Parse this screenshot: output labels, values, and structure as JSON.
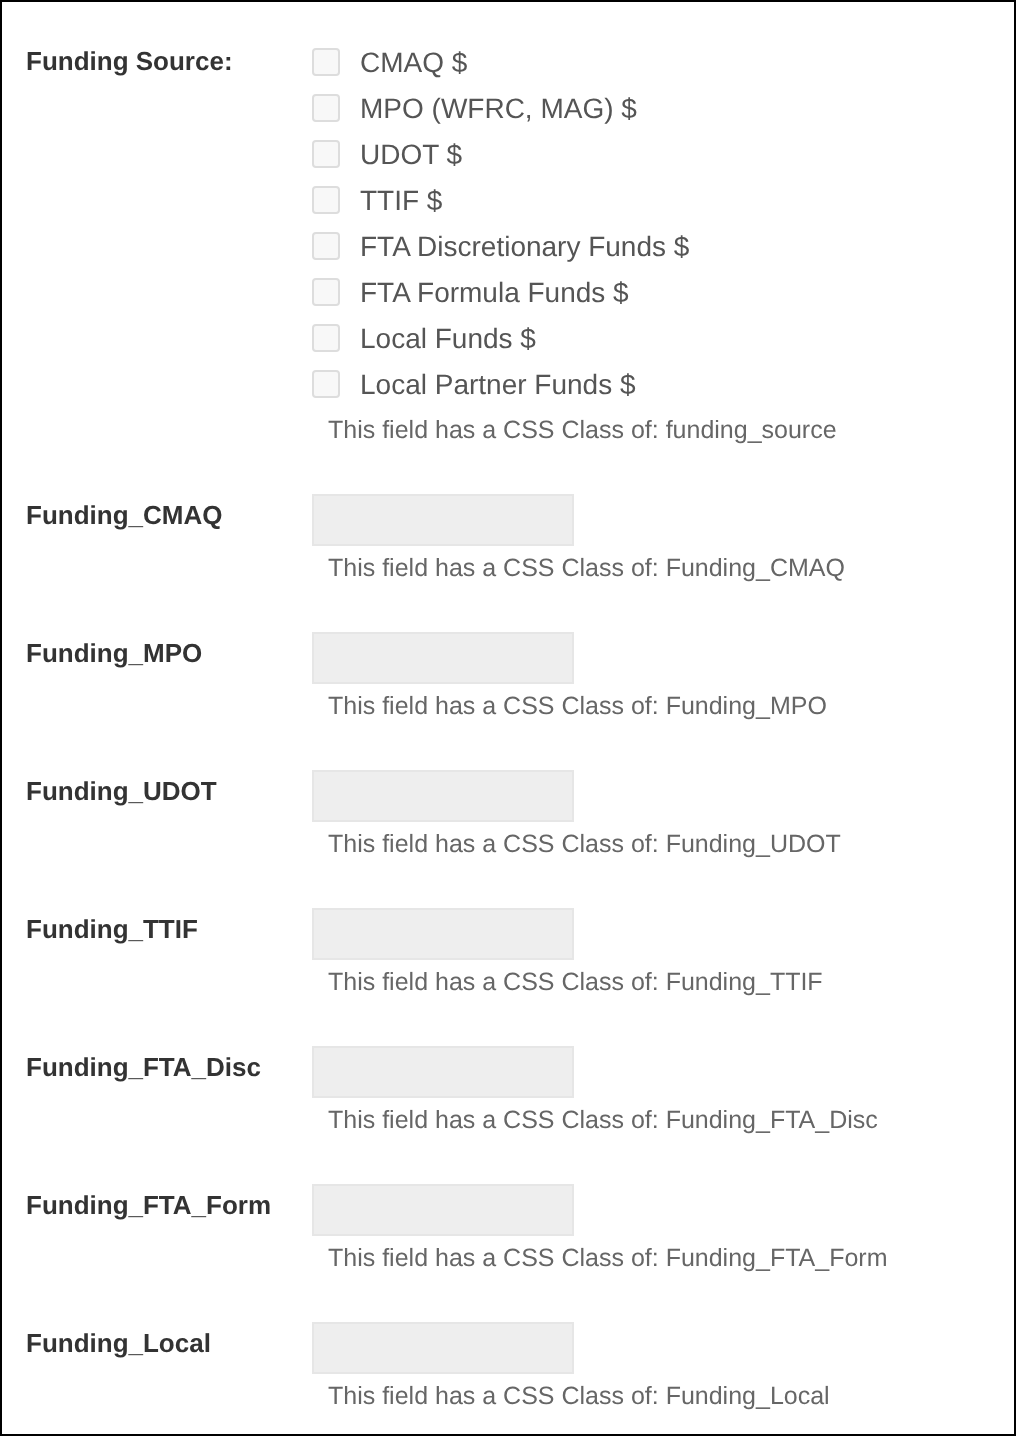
{
  "funding_source": {
    "label": "Funding Source:",
    "options": [
      {
        "label": "CMAQ $",
        "checked": false
      },
      {
        "label": "MPO (WFRC, MAG) $",
        "checked": false
      },
      {
        "label": "UDOT $",
        "checked": false
      },
      {
        "label": "TTIF $",
        "checked": false
      },
      {
        "label": "FTA Discretionary Funds $",
        "checked": false
      },
      {
        "label": "FTA Formula Funds $",
        "checked": false
      },
      {
        "label": "Local Funds $",
        "checked": false
      },
      {
        "label": "Local Partner Funds $",
        "checked": false
      }
    ],
    "help": "This field has a CSS Class of: funding_source"
  },
  "fields": [
    {
      "label": "Funding_CMAQ",
      "help": "This field has a CSS Class of: Funding_CMAQ"
    },
    {
      "label": "Funding_MPO",
      "help": "This field has a CSS Class of: Funding_MPO"
    },
    {
      "label": "Funding_UDOT",
      "help": "This field has a CSS Class of: Funding_UDOT"
    },
    {
      "label": "Funding_TTIF",
      "help": "This field has a CSS Class of: Funding_TTIF"
    },
    {
      "label": "Funding_FTA_Disc",
      "help": "This field has a CSS Class of: Funding_FTA_Disc"
    },
    {
      "label": "Funding_FTA_Form",
      "help": "This field has a CSS Class of: Funding_FTA_Form"
    },
    {
      "label": "Funding_Local",
      "help": "This field has a CSS Class of: Funding_Local"
    }
  ]
}
